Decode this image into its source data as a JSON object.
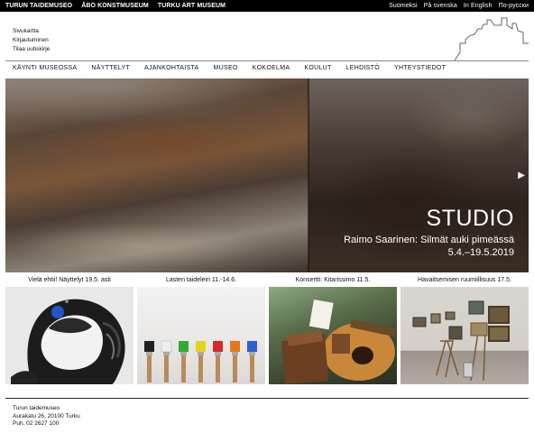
{
  "topbar": {
    "sites": [
      "TURUN TAIDEMUSEO",
      "ÅBO KONSTMUSEUM",
      "TURKU ART MUSEUM"
    ],
    "languages": [
      "Suomeksi",
      "På svenska",
      "In English",
      "По-русски"
    ]
  },
  "header": {
    "util_links": [
      "Sivukartta",
      "Kirjautuminen",
      "Tilaa uutiskirje"
    ]
  },
  "mainnav": {
    "items": [
      "KÄYNTI MUSEOSSA",
      "NÄYTTELYT",
      "AJANKOHTAISTA",
      "MUSEO",
      "KOKOELMA",
      "KOULUT",
      "LEHDISTÖ",
      "YHTEYSTIEDOT"
    ]
  },
  "hero": {
    "title": "STUDIO",
    "subtitle": "Raimo Saarinen: Silmät auki pimeässä",
    "dates": "5.4.–19.5.2019",
    "next_arrow": "▶"
  },
  "tiles": [
    {
      "label": "Vielä ehtii! Näyttelyt 19.5. asti"
    },
    {
      "label": "Lasten taideleiri 11.-14.6."
    },
    {
      "label": "Konsertti: Kitarissimo 11.5."
    },
    {
      "label": "Havaitsemisen ruumiillisuus 17.5."
    }
  ],
  "footer": {
    "name": "Turun taidemuseo",
    "address": "Aurakatu 26, 20100 Turku",
    "phone": "Puh. 02 2627 100"
  },
  "colors": {
    "topbar": "#000000",
    "text": "#111111",
    "hero_text": "#ffffff"
  }
}
